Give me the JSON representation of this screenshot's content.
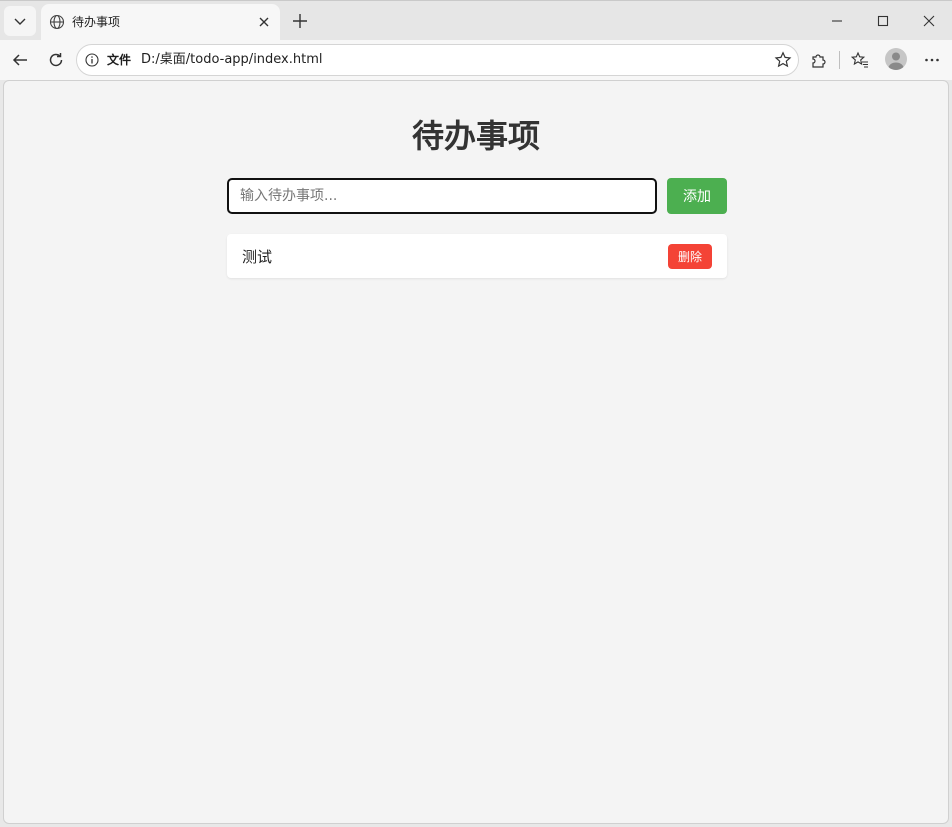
{
  "browser": {
    "tab": {
      "title": "待办事项",
      "icon": "globe-icon"
    },
    "toolbar": {
      "security_label": "文件",
      "url": "D:/桌面/todo-app/index.html"
    }
  },
  "app": {
    "title": "待办事项",
    "input": {
      "placeholder": "输入待办事项...",
      "value": ""
    },
    "add_label": "添加",
    "todos": [
      {
        "text": "测试",
        "delete_label": "删除"
      }
    ]
  },
  "colors": {
    "add_button": "#4caf50",
    "delete_button": "#f44336",
    "page_background": "#f4f4f4",
    "title_text": "#333333"
  }
}
